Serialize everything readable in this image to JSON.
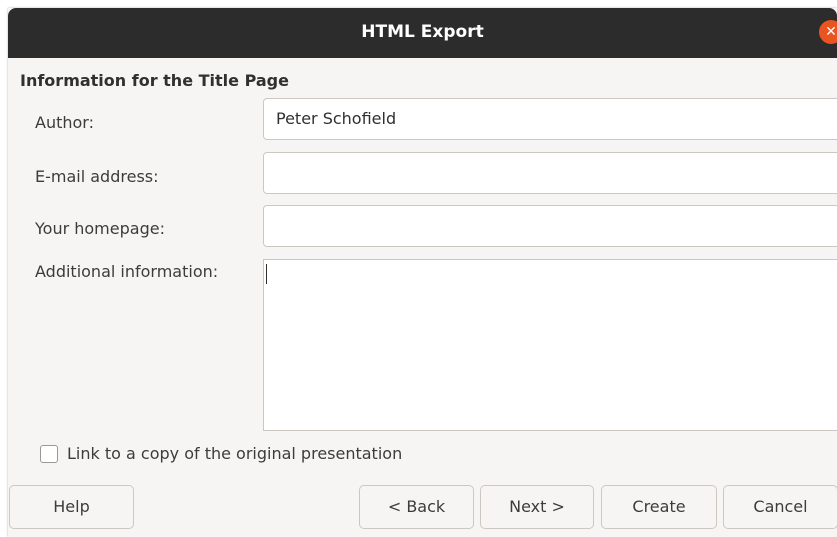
{
  "window": {
    "title": "HTML Export",
    "close_glyph": "✕"
  },
  "section_title": "Information for the Title Page",
  "fields": {
    "author": {
      "label": "Author:",
      "value": "Peter Schofield"
    },
    "email": {
      "label": "E-mail address:",
      "value": ""
    },
    "homepage": {
      "label": "Your homepage:",
      "value": ""
    },
    "additional": {
      "label": "Additional information:",
      "value": ""
    }
  },
  "checkbox": {
    "label": "Link to a copy of the original presentation",
    "checked": false
  },
  "buttons": {
    "help": "Help",
    "back": "< Back",
    "next": "Next >",
    "create": "Create",
    "cancel": "Cancel"
  }
}
